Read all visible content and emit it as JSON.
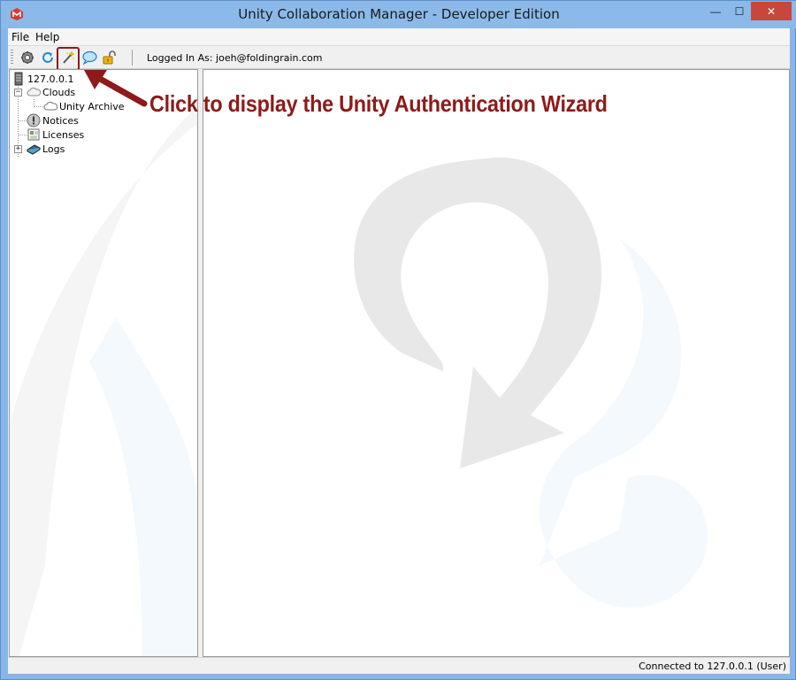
{
  "window": {
    "title": "Unity Collaboration Manager - Developer Edition",
    "controls": {
      "minimize": "—",
      "maximize": "☐",
      "close": "✕"
    }
  },
  "menubar": {
    "items": [
      {
        "label": "File"
      },
      {
        "label": "Help"
      }
    ]
  },
  "toolbar": {
    "buttons": [
      {
        "icon": "settings-gear-icon"
      },
      {
        "icon": "refresh-icon"
      },
      {
        "icon": "magic-wand-icon",
        "highlighted": true
      },
      {
        "icon": "speech-bubble-icon"
      },
      {
        "icon": "padlock-icon"
      }
    ],
    "logged_in_text": "Logged In As: joeh@foldingrain.com"
  },
  "tree": {
    "root": {
      "label": "127.0.0.1",
      "icon": "server-icon"
    },
    "nodes": [
      {
        "label": "Clouds",
        "icon": "clouds-icon",
        "expanded": true,
        "children": [
          {
            "label": "Unity Archive",
            "icon": "cloud-icon"
          }
        ]
      },
      {
        "label": "Notices",
        "icon": "notice-icon"
      },
      {
        "label": "Licenses",
        "icon": "license-icon"
      },
      {
        "label": "Logs",
        "icon": "log-book-icon",
        "expanded": false
      }
    ]
  },
  "annotation": {
    "text": "Click to display the Unity Authentication Wizard",
    "color": "#8e1a1a"
  },
  "statusbar": {
    "text": "Connected to 127.0.0.1 (User)"
  },
  "colors": {
    "titlebar": "#8bb9ea",
    "close_button": "#c9463d",
    "annotation": "#8e1a1a"
  }
}
